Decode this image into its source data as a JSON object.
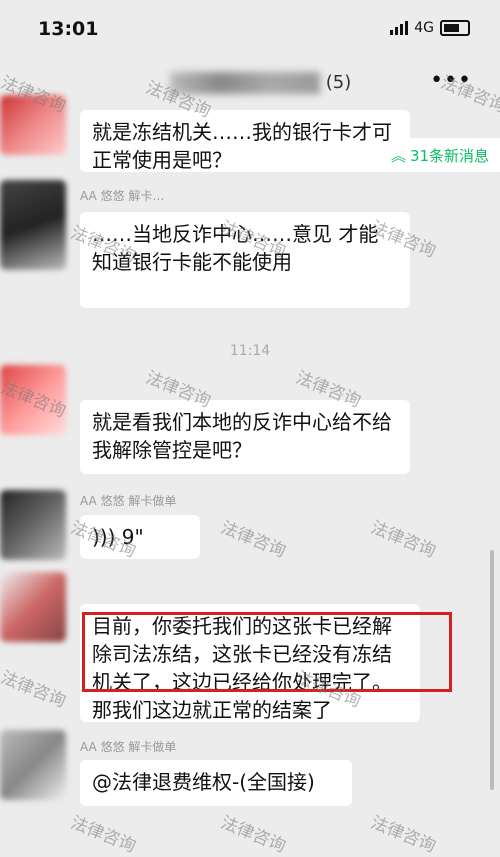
{
  "status": {
    "time": "13:01",
    "network": "4G"
  },
  "header": {
    "count": "(5)",
    "more": "•••"
  },
  "new_messages": "31条新消息",
  "messages": [
    {
      "text": "就是冻结机关……我的银行卡才可正常使用是吧？"
    },
    {
      "sender": "AA 悠悠 解卡…",
      "text": "……当地反诈中心……意见 才能知道银行卡能不能使用"
    },
    {
      "text": "就是看我们本地的反诈中心给不给我解除管控是吧？"
    },
    {
      "sender": "AA 悠悠 解卡做单",
      "voice": "9\""
    },
    {
      "text_main": "目前，你委托我们的这张卡已经解除司法冻结，这张卡已经没有冻结机关了，这边已经给你处理完了。",
      "text_tail": "那我们这边就正常的结案了"
    },
    {
      "sender": "AA 悠悠 解卡做单",
      "text": "@法律退费维权-(全国接)"
    }
  ],
  "timestamp": "11:14",
  "watermark": "法律咨询"
}
